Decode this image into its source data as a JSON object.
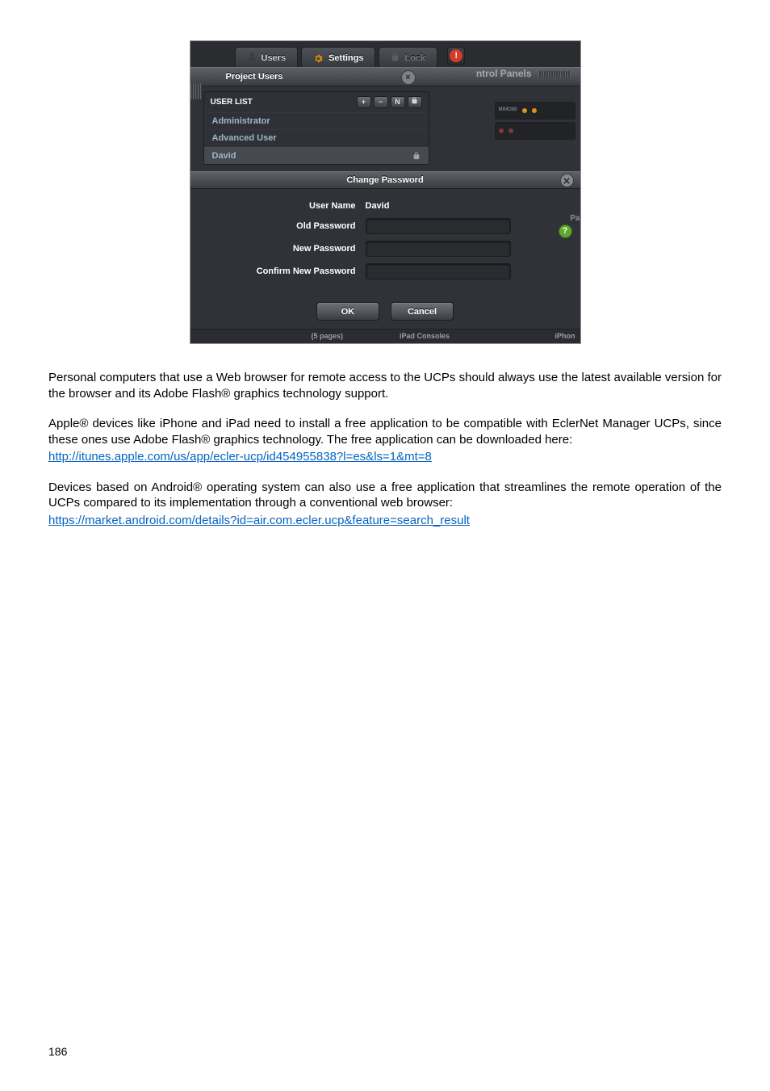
{
  "screenshot": {
    "tabs": {
      "users": "Users",
      "settings": "Settings",
      "lock": "Lock"
    },
    "project_users_title": "Project Users",
    "ntrol_label": "ntrol Panels",
    "userlist": {
      "heading": "USER LIST",
      "mini_btns": {
        "add": "+",
        "remove": "−",
        "rename": "N",
        "lockbtn": "lock"
      },
      "items": [
        {
          "label": "Administrator",
          "selected": false,
          "locked": false
        },
        {
          "label": "Advanced User",
          "selected": false,
          "locked": false
        },
        {
          "label": "David",
          "selected": true,
          "locked": true
        }
      ]
    },
    "thumb_caption": "MIMO88",
    "change_password": {
      "title": "Change Password",
      "labels": {
        "user_name": "User Name",
        "old_pw": "Old Password",
        "new_pw": "New Password",
        "confirm": "Confirm New Password"
      },
      "user_name_value": "David",
      "ok": "OK",
      "cancel": "Cancel",
      "help": "?",
      "pa": "Pa"
    },
    "bottom": {
      "pages": "(5 pages)",
      "ipad": "iPad Consoles",
      "iphone": "iPhon"
    }
  },
  "para1": "Personal computers that use a Web browser for remote access to the UCPs should always use the latest available version for the browser and its Adobe Flash® graphics technology support.",
  "para2": "Apple® devices like iPhone and iPad need to install a free application to be compatible with EclerNet Manager UCPs, since these ones use Adobe Flash® graphics technology. The free application can be downloaded here:",
  "link_itunes": "http://itunes.apple.com/us/app/ecler-ucp/id454955838?l=es&ls=1&mt=8",
  "para3": "Devices based on Android® operating system can also use a free application that streamlines the remote operation of the UCPs compared to its implementation through a conventional web browser:",
  "link_android": "https://market.android.com/details?id=air.com.ecler.ucp&feature=search_result",
  "page_number": "186"
}
